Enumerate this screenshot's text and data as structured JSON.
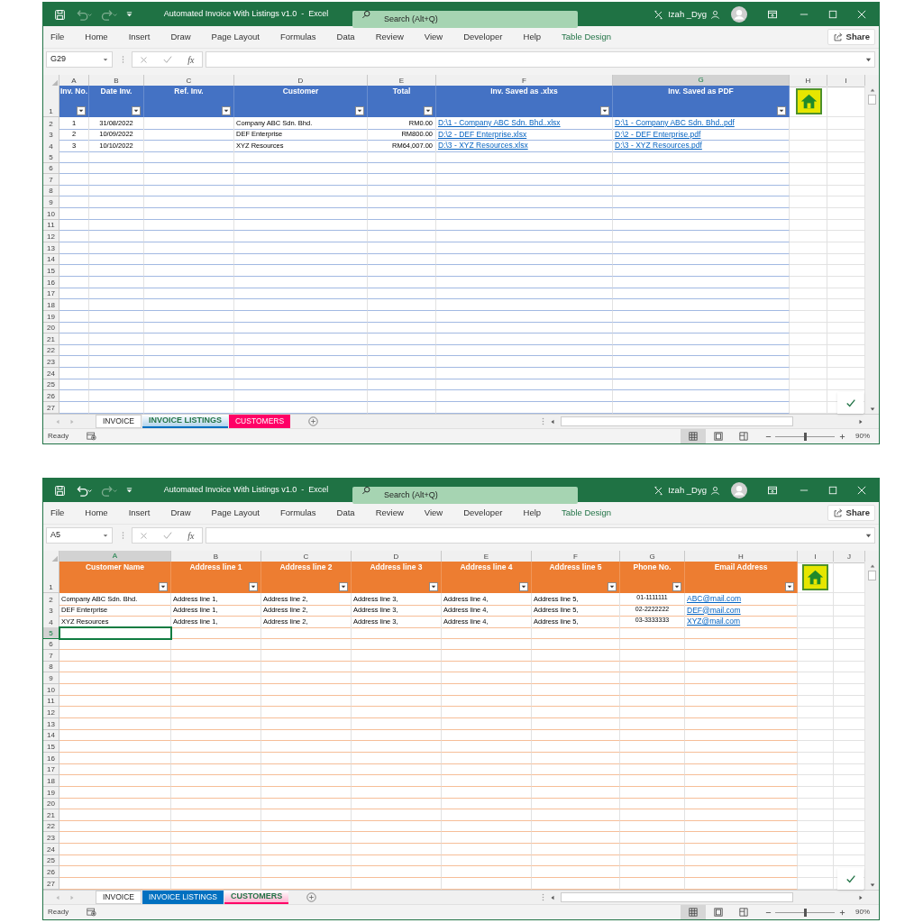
{
  "windows": [
    {
      "title": "Automated Invoice With Listings v1.0  -  Excel",
      "undo_enabled": false,
      "search": {
        "placeholder": "Search (Alt+Q)"
      },
      "user": "Izah _Dyg",
      "menu": [
        {
          "label": "File",
          "kind": "tab"
        },
        {
          "label": "Home",
          "kind": "tab"
        },
        {
          "label": "Insert",
          "kind": "tab"
        },
        {
          "label": "Draw",
          "kind": "tab"
        },
        {
          "label": "Page Layout",
          "kind": "tab"
        },
        {
          "label": "Formulas",
          "kind": "tab"
        },
        {
          "label": "Data",
          "kind": "tab"
        },
        {
          "label": "Review",
          "kind": "tab"
        },
        {
          "label": "View",
          "kind": "tab"
        },
        {
          "label": "Developer",
          "kind": "tab"
        },
        {
          "label": "Help",
          "kind": "tab"
        },
        {
          "label": "Table Design",
          "kind": "contextual"
        }
      ],
      "share": "Share",
      "name_box": "G29",
      "function_label": "fx",
      "columns": [
        {
          "label": "A",
          "selected": false
        },
        {
          "label": "B",
          "selected": false
        },
        {
          "label": "C",
          "selected": false
        },
        {
          "label": "D",
          "selected": false
        },
        {
          "label": "E",
          "selected": false
        },
        {
          "label": "F",
          "selected": false
        },
        {
          "label": "G",
          "selected": true
        },
        {
          "label": "H",
          "selected": false
        },
        {
          "label": "I",
          "selected": false
        }
      ],
      "rows": [
        {
          "label": "1",
          "selected": false
        },
        {
          "label": "2",
          "selected": false
        },
        {
          "label": "3",
          "selected": false
        },
        {
          "label": "4",
          "selected": false
        },
        {
          "label": "5",
          "selected": false
        },
        {
          "label": "6",
          "selected": false
        },
        {
          "label": "7",
          "selected": false
        },
        {
          "label": "8",
          "selected": false
        },
        {
          "label": "9",
          "selected": false
        },
        {
          "label": "10",
          "selected": false
        },
        {
          "label": "11",
          "selected": false
        },
        {
          "label": "12",
          "selected": false
        },
        {
          "label": "13",
          "selected": false
        },
        {
          "label": "14",
          "selected": false
        },
        {
          "label": "15",
          "selected": false
        },
        {
          "label": "16",
          "selected": false
        },
        {
          "label": "17",
          "selected": false
        },
        {
          "label": "18",
          "selected": false
        },
        {
          "label": "19",
          "selected": false
        },
        {
          "label": "20",
          "selected": false
        },
        {
          "label": "21",
          "selected": false
        },
        {
          "label": "22",
          "selected": false
        },
        {
          "label": "23",
          "selected": false
        },
        {
          "label": "24",
          "selected": false
        },
        {
          "label": "25",
          "selected": false
        },
        {
          "label": "26",
          "selected": false
        },
        {
          "label": "27",
          "selected": false
        }
      ],
      "table": {
        "color": "#4472c4",
        "columns": [
          {
            "header": "Inv. No.",
            "kind": "center"
          },
          {
            "header": "Date Inv.",
            "kind": "center"
          },
          {
            "header": "Ref. Inv.",
            "kind": "text"
          },
          {
            "header": "Customer",
            "kind": "text"
          },
          {
            "header": "Total",
            "kind": "number"
          },
          {
            "header": "Inv. Saved as .xlxs",
            "kind": "link"
          },
          {
            "header": "Inv. Saved as PDF",
            "kind": "link"
          }
        ],
        "rows": [
          [
            "1",
            "31/08/2022",
            null,
            "Company ABC Sdn. Bhd.",
            "RM0.00",
            "D:\\1 - Company ABC Sdn. Bhd..xlsx",
            "D:\\1 - Company ABC Sdn. Bhd..pdf"
          ],
          [
            "2",
            "10/09/2022",
            null,
            "DEF Enterprise",
            "RM800.00",
            "D:\\2 - DEF Enterprise.xlsx",
            "D:\\2 - DEF Enterprise.pdf"
          ],
          [
            "3",
            "10/10/2022",
            null,
            "XYZ Resources",
            "RM64,007.00",
            "D:\\3 - XYZ Resources.xlsx",
            "D:\\3 - XYZ Resources.pdf"
          ]
        ]
      },
      "sheet_tabs": [
        {
          "label": "INVOICE",
          "selected": false
        },
        {
          "label": "INVOICE LISTINGS",
          "selected": true,
          "color": "#0070c0"
        },
        {
          "label": "CUSTOMERS",
          "selected": false,
          "color": "#ff0066"
        }
      ],
      "status": "Ready",
      "zoom": {
        "level": 0.5,
        "reading": "90%"
      }
    },
    {
      "title": "Automated Invoice With Listings v1.0  -  Excel",
      "undo_enabled": true,
      "search": {
        "placeholder": "Search (Alt+Q)"
      },
      "user": "Izah _Dyg",
      "menu": [
        {
          "label": "File",
          "kind": "tab"
        },
        {
          "label": "Home",
          "kind": "tab"
        },
        {
          "label": "Insert",
          "kind": "tab"
        },
        {
          "label": "Draw",
          "kind": "tab"
        },
        {
          "label": "Page Layout",
          "kind": "tab"
        },
        {
          "label": "Formulas",
          "kind": "tab"
        },
        {
          "label": "Data",
          "kind": "tab"
        },
        {
          "label": "Review",
          "kind": "tab"
        },
        {
          "label": "View",
          "kind": "tab"
        },
        {
          "label": "Developer",
          "kind": "tab"
        },
        {
          "label": "Help",
          "kind": "tab"
        },
        {
          "label": "Table Design",
          "kind": "contextual"
        }
      ],
      "share": "Share",
      "name_box": "A5",
      "function_label": "fx",
      "columns": [
        {
          "label": "A",
          "selected": true
        },
        {
          "label": "B",
          "selected": false
        },
        {
          "label": "C",
          "selected": false
        },
        {
          "label": "D",
          "selected": false
        },
        {
          "label": "E",
          "selected": false
        },
        {
          "label": "F",
          "selected": false
        },
        {
          "label": "G",
          "selected": false
        },
        {
          "label": "H",
          "selected": false
        },
        {
          "label": "I",
          "selected": false
        },
        {
          "label": "J",
          "selected": false
        }
      ],
      "rows": [
        {
          "label": "1",
          "selected": false
        },
        {
          "label": "2",
          "selected": false
        },
        {
          "label": "3",
          "selected": false
        },
        {
          "label": "4",
          "selected": false
        },
        {
          "label": "5",
          "selected": true
        },
        {
          "label": "6",
          "selected": false
        },
        {
          "label": "7",
          "selected": false
        },
        {
          "label": "8",
          "selected": false
        },
        {
          "label": "9",
          "selected": false
        },
        {
          "label": "10",
          "selected": false
        },
        {
          "label": "11",
          "selected": false
        },
        {
          "label": "12",
          "selected": false
        },
        {
          "label": "13",
          "selected": false
        },
        {
          "label": "14",
          "selected": false
        },
        {
          "label": "15",
          "selected": false
        },
        {
          "label": "16",
          "selected": false
        },
        {
          "label": "17",
          "selected": false
        },
        {
          "label": "18",
          "selected": false
        },
        {
          "label": "19",
          "selected": false
        },
        {
          "label": "20",
          "selected": false
        },
        {
          "label": "21",
          "selected": false
        },
        {
          "label": "22",
          "selected": false
        },
        {
          "label": "23",
          "selected": false
        },
        {
          "label": "24",
          "selected": false
        },
        {
          "label": "25",
          "selected": false
        },
        {
          "label": "26",
          "selected": false
        },
        {
          "label": "27",
          "selected": false
        }
      ],
      "table": {
        "color": "#ed7d31",
        "columns": [
          {
            "header": "Customer Name",
            "kind": "text"
          },
          {
            "header": "Address line 1",
            "kind": "text"
          },
          {
            "header": "Address line 2",
            "kind": "text"
          },
          {
            "header": "Address line 3",
            "kind": "text"
          },
          {
            "header": "Address line 4",
            "kind": "text"
          },
          {
            "header": "Address line 5",
            "kind": "text"
          },
          {
            "header": "Phone No.",
            "kind": "phone"
          },
          {
            "header": "Email Address",
            "kind": "link"
          }
        ],
        "rows": [
          [
            "Company ABC Sdn. Bhd.",
            "Address line 1,",
            "Address line 2,",
            "Address line 3,",
            "Address line 4,",
            "Address line 5,",
            "01-1111111",
            "ABC@mail.com"
          ],
          [
            "DEF Enterprise",
            "Address line 1,",
            "Address line 2,",
            "Address line 3,",
            "Address line 4,",
            "Address line 5,",
            "02-2222222",
            "DEF@mail.com"
          ],
          [
            "XYZ Resources",
            "Address line 1,",
            "Address line 2,",
            "Address line 3,",
            "Address line 4,",
            "Address line 5,",
            "03-3333333",
            "XYZ@mail.com"
          ]
        ]
      },
      "sheet_tabs": [
        {
          "label": "INVOICE",
          "selected": false
        },
        {
          "label": "INVOICE LISTINGS",
          "selected": false,
          "color": "#0070c0"
        },
        {
          "label": "CUSTOMERS",
          "selected": true,
          "color": "#ff0066"
        }
      ],
      "status": "Ready",
      "zoom": {
        "level": 0.5,
        "reading": "90%"
      }
    }
  ]
}
